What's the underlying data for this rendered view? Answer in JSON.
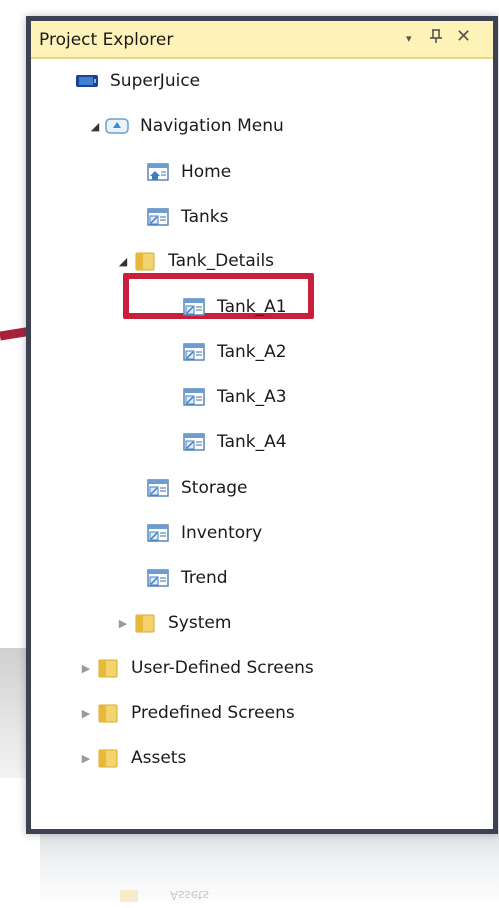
{
  "panel": {
    "title": "Project Explorer",
    "controls": {
      "dropdown": "▾",
      "pin": "⊥",
      "close": "✕"
    }
  },
  "tree": {
    "project": "SuperJuice",
    "navigation_menu": "Navigation Menu",
    "home": "Home",
    "tanks": "Tanks",
    "tank_details": "Tank_Details",
    "tank_a1": "Tank_A1",
    "tank_a2": "Tank_A2",
    "tank_a3": "Tank_A3",
    "tank_a4": "Tank_A4",
    "storage": "Storage",
    "inventory": "Inventory",
    "trend": "Trend",
    "system": "System",
    "user_defined_screens": "User-Defined Screens",
    "predefined_screens": "Predefined Screens",
    "assets": "Assets"
  },
  "highlighted_item": "Tank_A1",
  "reflection_text": "Assets",
  "colors": {
    "title_bar": "#fdf3b8",
    "panel_border": "#3c4252",
    "highlight": "#c8203c",
    "folder": "#f0c23a"
  }
}
